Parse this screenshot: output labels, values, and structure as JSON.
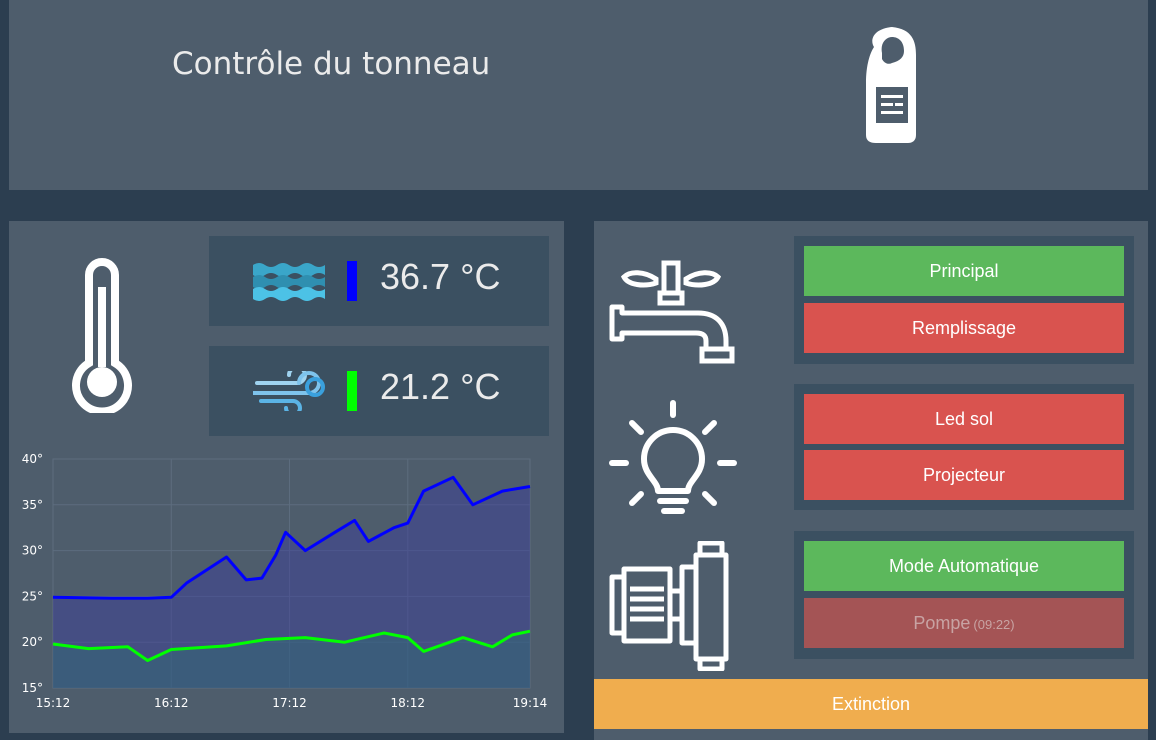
{
  "header": {
    "title": "Contrôle du tonneau",
    "icon": "door-hanger-icon"
  },
  "temperatures": {
    "water": {
      "icon": "water-waves-icon",
      "value": "36.7 °C",
      "color": "#0000ff"
    },
    "air": {
      "icon": "wind-icon",
      "value": "21.2 °C",
      "color": "#00ff00"
    }
  },
  "chart_data": {
    "type": "area",
    "x_ticks": [
      "15:12",
      "16:12",
      "17:12",
      "18:12",
      "19:14"
    ],
    "y_ticks": [
      "40°",
      "35°",
      "30°",
      "25°",
      "20°",
      "15°"
    ],
    "ylim": [
      15,
      40
    ],
    "grid": true,
    "series": [
      {
        "color": "#0000ff",
        "x": [
          "15:12",
          "15:42",
          "16:00",
          "16:12",
          "16:20",
          "16:40",
          "16:50",
          "16:58",
          "17:05",
          "17:10",
          "17:20",
          "17:35",
          "17:45",
          "17:52",
          "18:05",
          "18:12",
          "18:20",
          "18:35",
          "18:45",
          "19:00",
          "19:14"
        ],
        "values": [
          24.9,
          24.8,
          24.8,
          24.9,
          26.5,
          29.3,
          26.8,
          27.0,
          29.5,
          32.0,
          30.0,
          32.0,
          33.3,
          31.0,
          32.5,
          33.0,
          36.5,
          38.0,
          35.0,
          36.5,
          37.0
        ]
      },
      {
        "color": "#00ff00",
        "x": [
          "15:12",
          "15:30",
          "15:50",
          "16:00",
          "16:12",
          "16:40",
          "17:00",
          "17:20",
          "17:40",
          "18:00",
          "18:12",
          "18:20",
          "18:40",
          "18:55",
          "19:05",
          "19:14"
        ],
        "values": [
          19.8,
          19.3,
          19.5,
          18.0,
          19.2,
          19.6,
          20.3,
          20.5,
          20.0,
          21.0,
          20.5,
          19.0,
          20.5,
          19.5,
          20.8,
          21.2
        ]
      }
    ]
  },
  "controls": {
    "tap_icon": "water-tap-icon",
    "bulb_icon": "light-bulb-icon",
    "pump_icon": "pump-icon",
    "principal": "Principal",
    "remplissage": "Remplissage",
    "led_sol": "Led sol",
    "projecteur": "Projecteur",
    "mode_auto": "Mode Automatique",
    "pompe": "Pompe",
    "pompe_time": "(09:22)",
    "extinction": "Extinction"
  },
  "colors": {
    "background": "#2c3e50",
    "panel": "#4e5d6c",
    "box": "#3b5061",
    "success": "#5cb85c",
    "danger": "#d9534f",
    "warning": "#f0ad4e"
  }
}
